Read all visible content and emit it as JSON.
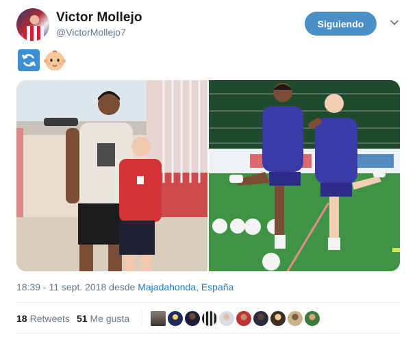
{
  "tweet": {
    "author_name": "Victor Mollejo",
    "author_handle": "@VictorMollejo7",
    "follow_label": "Siguiendo",
    "emoji_refresh": "refresh-emoji",
    "emoji_baby": "baby-emoji",
    "photos": [
      {
        "name": "photo-boy-with-player-stadium"
      },
      {
        "name": "photo-training-stretch"
      }
    ],
    "timestamp": "18:39 - 11 sept. 2018 desde",
    "location": "Majadahonda, España"
  },
  "stats": {
    "retweets_count": "18",
    "retweets_label": "Retweets",
    "likes_count": "51",
    "likes_label": "Me gusta",
    "liker_count": 10
  },
  "colors": {
    "follow_button": "#4a90c6",
    "link": "#1d7bbf",
    "muted": "#657786"
  }
}
